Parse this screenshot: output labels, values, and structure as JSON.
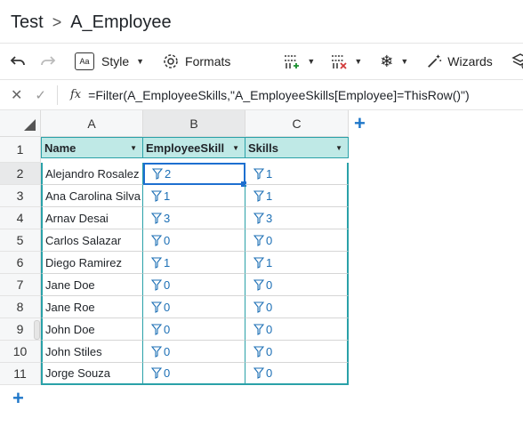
{
  "breadcrumb": {
    "parent": "Test",
    "separator": ">",
    "current": "A_Employee"
  },
  "toolbar": {
    "style_label": "Style",
    "formats_label": "Formats",
    "wizards_label": "Wizards",
    "aa_label": "Aa"
  },
  "formula": {
    "fx_label": "fx",
    "text": "=Filter(A_EmployeeSkills,\"A_EmployeeSkills[Employee]=ThisRow()\")"
  },
  "columns": [
    "A",
    "B",
    "C"
  ],
  "row_numbers": [
    "1",
    "2",
    "3",
    "4",
    "5",
    "6",
    "7",
    "8",
    "9",
    "10",
    "11"
  ],
  "table": {
    "headers": [
      "Name",
      "EmployeeSkill",
      "Skills"
    ],
    "rows": [
      {
        "name": "Alejandro Rosalez",
        "employee_skill": "2",
        "skills": "1"
      },
      {
        "name": "Ana Carolina Silva",
        "employee_skill": "1",
        "skills": "1"
      },
      {
        "name": "Arnav Desai",
        "employee_skill": "3",
        "skills": "3"
      },
      {
        "name": "Carlos Salazar",
        "employee_skill": "0",
        "skills": "0"
      },
      {
        "name": "Diego Ramirez",
        "employee_skill": "1",
        "skills": "1"
      },
      {
        "name": "Jane Doe",
        "employee_skill": "0",
        "skills": "0"
      },
      {
        "name": "Jane Roe",
        "employee_skill": "0",
        "skills": "0"
      },
      {
        "name": "John Doe",
        "employee_skill": "0",
        "skills": "0"
      },
      {
        "name": "John Stiles",
        "employee_skill": "0",
        "skills": "0"
      },
      {
        "name": "Jorge Souza",
        "employee_skill": "0",
        "skills": "0"
      }
    ]
  },
  "colors": {
    "accent": "#2aa1a8",
    "header_fill": "#bfe9e6",
    "link": "#1c6fb5",
    "add": "#1f77c9"
  }
}
